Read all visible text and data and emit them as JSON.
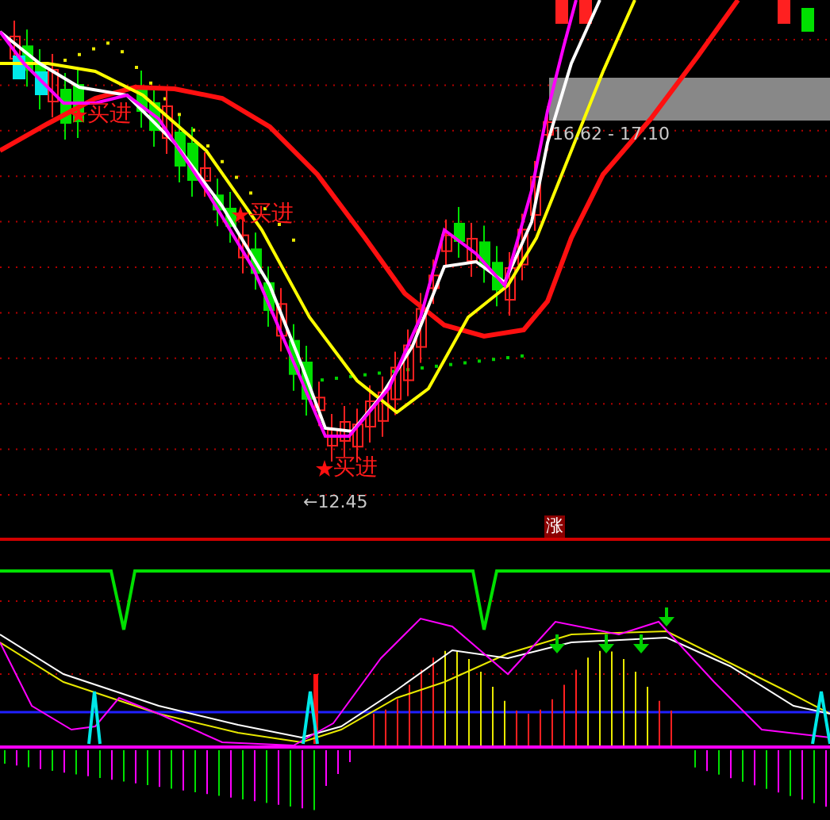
{
  "main_chart": {
    "buy_signals": [
      {
        "label": "买进"
      },
      {
        "label": "买进"
      },
      {
        "label": "买进"
      }
    ],
    "range_label": "16.62 - 17.10",
    "low_label": "←12.45"
  },
  "divider_badge": "涨"
}
